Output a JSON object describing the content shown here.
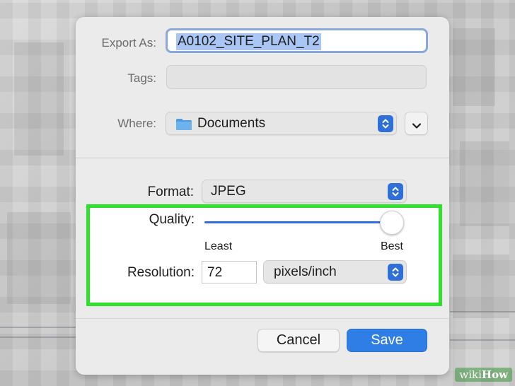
{
  "dialog": {
    "export_as_label": "Export As:",
    "export_as_value": "A0102_SITE_PLAN_T2",
    "tags_label": "Tags:",
    "tags_value": "",
    "where_label": "Where:",
    "where_value": "Documents",
    "format_label": "Format:",
    "format_value": "JPEG",
    "quality_label": "Quality:",
    "quality_level": 1.0,
    "quality_min_label": "Least",
    "quality_max_label": "Best",
    "resolution_label": "Resolution:",
    "resolution_value": "72",
    "resolution_unit": "pixels/inch",
    "cancel_label": "Cancel",
    "save_label": "Save"
  },
  "watermark": {
    "prefix": "wiki",
    "suffix": "How"
  },
  "colors": {
    "accent": "#2f7ee6",
    "highlight_border": "#2fe02f",
    "selection": "#a9c6f5"
  }
}
